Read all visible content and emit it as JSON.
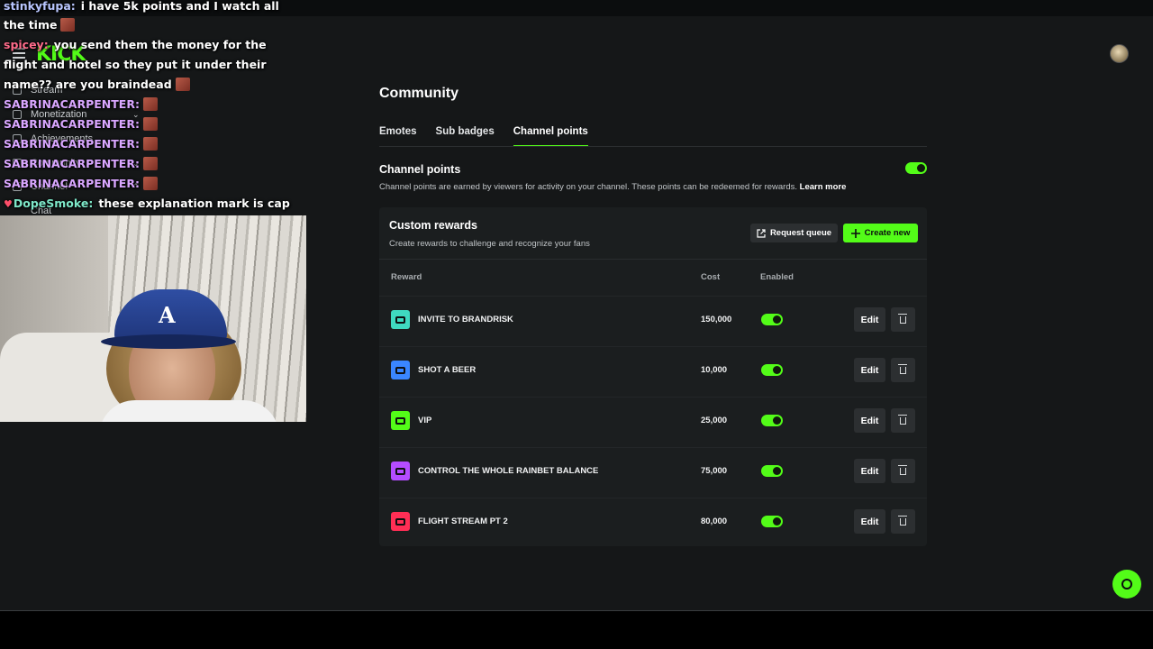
{
  "site": {
    "logo": "KICK"
  },
  "sidebar": {
    "items": [
      {
        "label": "Stream",
        "icon": "broadcast-icon"
      },
      {
        "label": "Monetization",
        "icon": "money-icon",
        "chevron": "⌄"
      },
      {
        "label": "Achievements",
        "icon": "trophy-icon"
      },
      {
        "label": "Community",
        "icon": "people-icon",
        "chevron": "⌄"
      },
      {
        "label": "Channel",
        "icon": "channel-icon",
        "chevron": "⌃"
      },
      {
        "label": "Chat",
        "icon": "chat-icon"
      }
    ]
  },
  "chat": {
    "messages": [
      {
        "user": "stinkyfupa:",
        "user_color": "#b9c6ff",
        "text": "i have 5k points and I watch all",
        "emote": false
      },
      {
        "user": "",
        "user_color": "#ffffff",
        "text": "the time",
        "emote": true
      },
      {
        "user": "spicey:",
        "user_color": "#ff6b8a",
        "text": "you send them the money for the",
        "emote": false
      },
      {
        "user": "",
        "user_color": "#ffffff",
        "text": "flight and hotel so they put it under their",
        "emote": false
      },
      {
        "user": "",
        "user_color": "#ffffff",
        "text": "name?? are you braindead",
        "emote": true
      },
      {
        "user": "SABRINACARPENTER:",
        "user_color": "#d9a6ff",
        "text": "",
        "emote": true
      },
      {
        "user": "SABRINACARPENTER:",
        "user_color": "#d9a6ff",
        "text": "",
        "emote": true
      },
      {
        "user": "SABRINACARPENTER:",
        "user_color": "#d9a6ff",
        "text": "",
        "emote": true
      },
      {
        "user": "SABRINACARPENTER:",
        "user_color": "#d9a6ff",
        "text": "",
        "emote": true
      },
      {
        "user": "SABRINACARPENTER:",
        "user_color": "#d9a6ff",
        "text": "",
        "emote": true
      },
      {
        "user": "DopeSmoke:",
        "user_color": "#7ee8c9",
        "text": "these explanation mark is cap",
        "emote": false,
        "badge": "♥"
      }
    ]
  },
  "main": {
    "title": "Community",
    "tabs": [
      {
        "label": "Emotes",
        "active": false
      },
      {
        "label": "Sub badges",
        "active": false
      },
      {
        "label": "Channel points",
        "active": true
      }
    ],
    "channel_points": {
      "title": "Channel points",
      "description": "Channel points are earned by viewers for activity on your channel. These points can be redeemed for rewards.",
      "learn_more": "Learn more",
      "enabled": true
    },
    "custom_rewards": {
      "title": "Custom rewards",
      "description": "Create rewards to challenge and recognize your fans",
      "request_queue_label": "Request queue",
      "create_new_label": "Create new",
      "columns": {
        "reward": "Reward",
        "cost": "Cost",
        "enabled": "Enabled"
      },
      "edit_label": "Edit",
      "rows": [
        {
          "name": "INVITE TO BRANDRISK",
          "cost": "150,000",
          "enabled": true,
          "color": "#3fd9c0"
        },
        {
          "name": "SHOT A BEER",
          "cost": "10,000",
          "enabled": true,
          "color": "#3a86ff"
        },
        {
          "name": "VIP",
          "cost": "25,000",
          "enabled": true,
          "color": "#53fc18"
        },
        {
          "name": "CONTROL THE WHOLE RAINBET BALANCE",
          "cost": "75,000",
          "enabled": true,
          "color": "#b44cff"
        },
        {
          "name": "FLIGHT STREAM PT 2",
          "cost": "80,000",
          "enabled": true,
          "color": "#ff2e55"
        }
      ]
    }
  },
  "colors": {
    "accent": "#53fc18",
    "background": "#151718",
    "panel": "#1b1e1f"
  }
}
